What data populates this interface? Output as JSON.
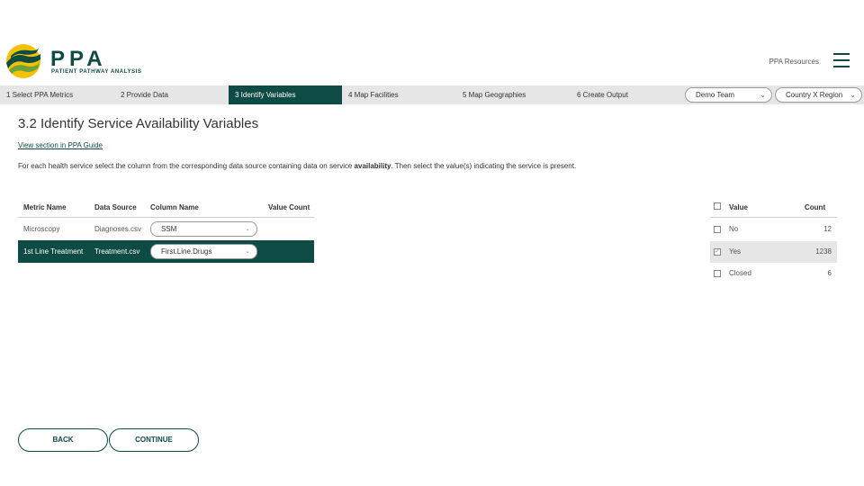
{
  "header": {
    "brand": "PPA",
    "brand_sub": "PATIENT PATHWAY ANALYSIS",
    "resources_label": "PPA Resources",
    "menu_icon": "hamburger-icon",
    "colors": {
      "primary": "#0e4b44",
      "accent_yellow": "#f2c200",
      "accent_green": "#6da33c"
    }
  },
  "steps": [
    {
      "label": "1 Select PPA Metrics"
    },
    {
      "label": "2 Provide Data"
    },
    {
      "label": "3 Identify Variables"
    },
    {
      "label": "4 Map Facilities"
    },
    {
      "label": "5 Map Geographies"
    },
    {
      "label": "6 Create Output"
    }
  ],
  "nav": {
    "team": "Demo Team",
    "region": "Country X Region"
  },
  "page": {
    "title": "3.2 Identify Service Availability Variables",
    "guide_link": "View section in PPA Guide",
    "instructions_before": "For each health service select the column from the corresponding data source containing data on service ",
    "instructions_bold": "availability",
    "instructions_after": ". Then select the value(s) indicating the service is present."
  },
  "metrics_table": {
    "headers": {
      "metric": "Metric Name",
      "source": "Data Source",
      "column": "Column Name",
      "count": "Value Count"
    },
    "rows": [
      {
        "metric": "Microscopy",
        "source": "Diagnoses.csv",
        "column": "SSM"
      },
      {
        "metric": "1st Line Treatment",
        "source": "Treatment.csv",
        "column": "First.Line.Drugs"
      }
    ]
  },
  "values_table": {
    "headers": {
      "value": "Value",
      "count": "Count"
    },
    "rows": [
      {
        "value": "No",
        "count": "12",
        "checked": false
      },
      {
        "value": "Yes",
        "count": "1238",
        "checked": true
      },
      {
        "value": "Closed",
        "count": "6",
        "checked": false
      }
    ]
  },
  "buttons": {
    "back": "BACK",
    "continue": "CONTINUE"
  }
}
